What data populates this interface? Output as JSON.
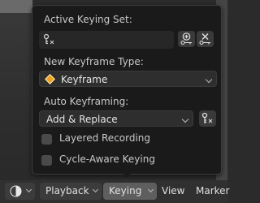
{
  "popup": {
    "active_set_label": "Active Keying Set:",
    "keyframe_type_label": "New Keyframe Type:",
    "keyframe_type_value": "Keyframe",
    "auto_keyframing_label": "Auto Keyframing:",
    "auto_mode_value": "Add & Replace",
    "layered_recording_label": "Layered Recording",
    "layered_recording_checked": false,
    "cycle_aware_label": "Cycle-Aware Keying",
    "cycle_aware_checked": false,
    "colors": {
      "keyframe_diamond": "#f0a020",
      "background": "#1a1a1a"
    }
  },
  "header": {
    "playback_label": "Playback",
    "keying_label": "Keying",
    "view_label": "View",
    "marker_label": "Marker"
  },
  "icons": [
    "keying-set-icon",
    "add-keying-set-icon",
    "remove-keying-set-icon",
    "keyframe-diamond-icon",
    "auto-keying-set-icon",
    "editor-type-icon"
  ]
}
